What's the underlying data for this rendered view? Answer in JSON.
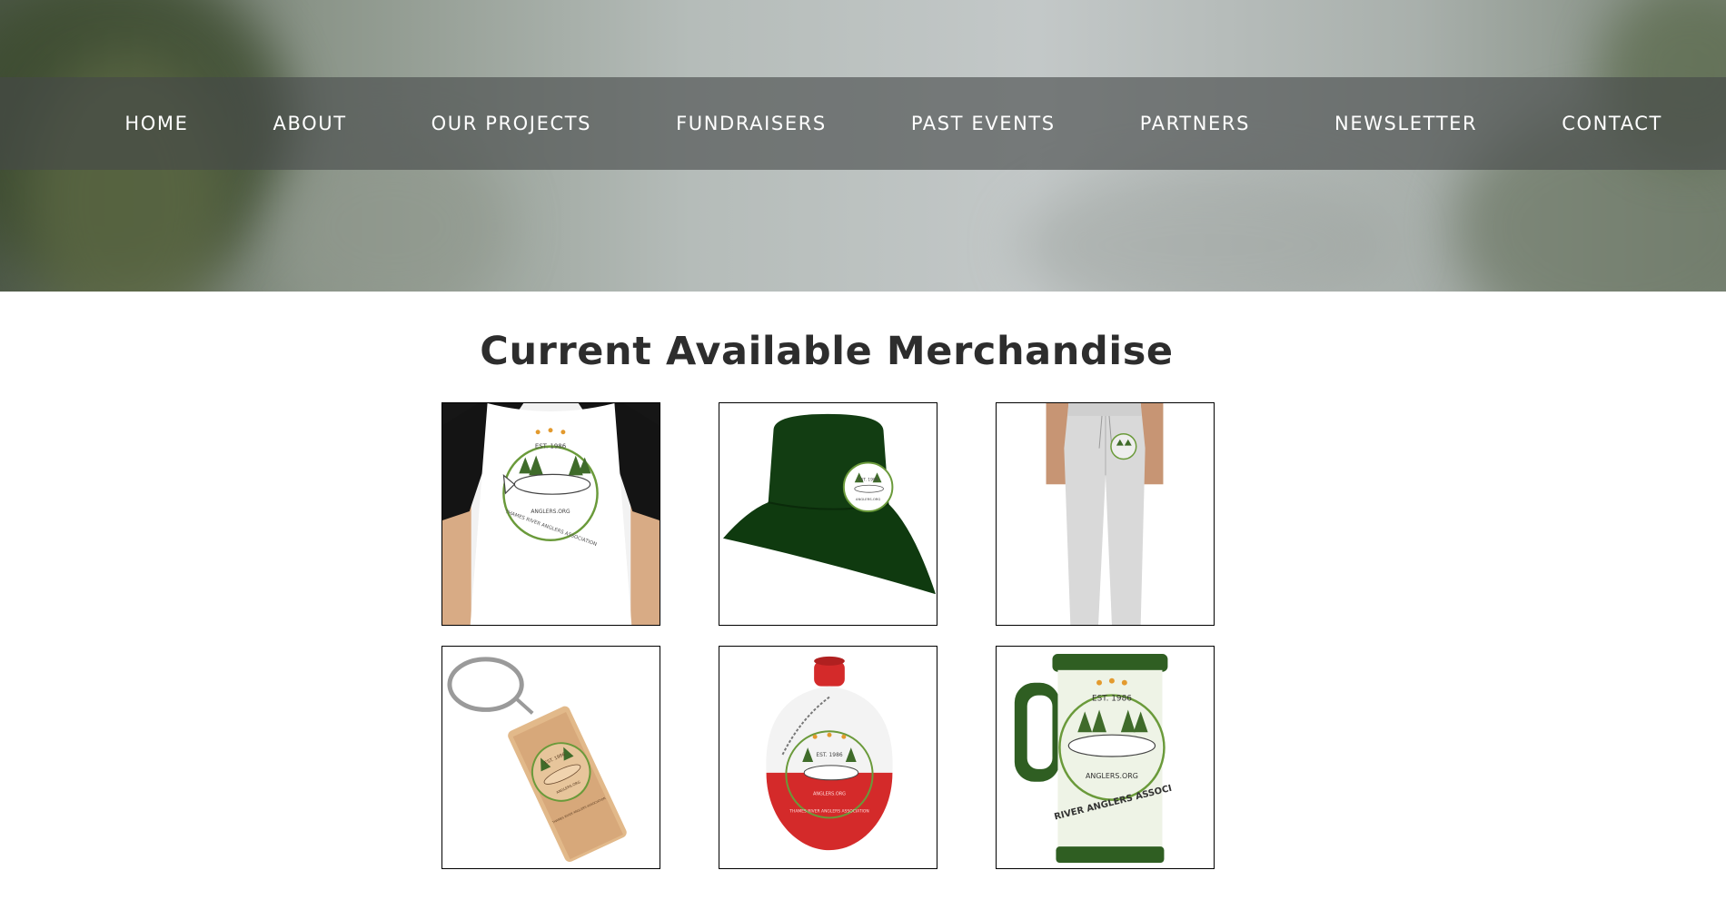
{
  "nav": {
    "items": [
      {
        "label": "HOME"
      },
      {
        "label": "ABOUT"
      },
      {
        "label": "OUR PROJECTS"
      },
      {
        "label": "FUNDRAISERS"
      },
      {
        "label": "PAST EVENTS"
      },
      {
        "label": "PARTNERS"
      },
      {
        "label": "NEWSLETTER"
      },
      {
        "label": "CONTACT"
      }
    ]
  },
  "main": {
    "title": "Current Available Merchandise"
  },
  "products": [
    {
      "icon": "raglan-tshirt-image",
      "logo_est": "EST. 1986",
      "logo_site": "ANGLERS.ORG",
      "logo_name": "THAMES RIVER ANGLERS ASSOCIATION"
    },
    {
      "icon": "bucket-hat-image",
      "logo_est": "EST. 1986",
      "logo_site": "ANGLERS.ORG"
    },
    {
      "icon": "sweatpants-image"
    },
    {
      "icon": "wooden-keychain-image",
      "logo_est": "EST. 1986",
      "logo_site": "ANGLERS.ORG",
      "logo_name": "THAMES RIVER ANGLERS ASSOCIATION"
    },
    {
      "icon": "fishing-bobber-image",
      "logo_est": "EST. 1986",
      "logo_site": "ANGLERS.ORG",
      "logo_name": "THAMES RIVER ANGLERS ASSOCIATION"
    },
    {
      "icon": "travel-mug-image",
      "logo_est": "EST. 1986",
      "logo_site": "ANGLERS.ORG",
      "logo_name": "RIVER ANGLERS ASSOCI"
    }
  ],
  "colors": {
    "logo_green": "#6a9a3a",
    "tree_green": "#3f6b2a",
    "hat_green": "#123d12",
    "bobber_red": "#d42a2a",
    "nav_text": "#ffffff",
    "title_text": "#2d2d2d"
  }
}
